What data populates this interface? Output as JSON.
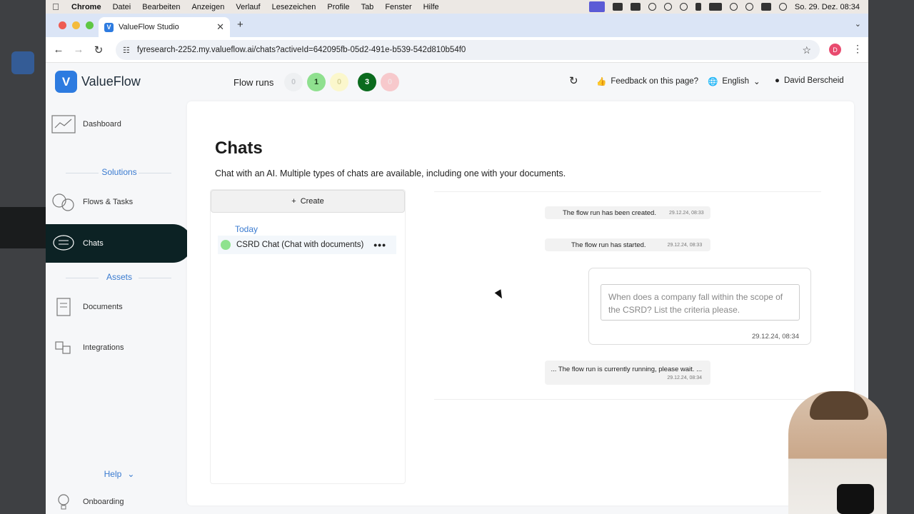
{
  "menubar": {
    "app": "Chrome",
    "items": [
      "Datei",
      "Bearbeiten",
      "Anzeigen",
      "Verlauf",
      "Lesezeichen",
      "Profile",
      "Tab",
      "Fenster",
      "Hilfe"
    ],
    "clock": "So. 29. Dez. 08:34"
  },
  "browser": {
    "tab_title": "ValueFlow Studio",
    "url": "fyresearch-2252.my.valueflow.ai/chats?activeId=642095fb-05d2-491e-b539-542d810b54f0",
    "profile_initial": "D"
  },
  "header": {
    "brand": "ValueFlow",
    "flow_runs_label": "Flow runs",
    "flow_runs": [
      {
        "value": "0",
        "bg": "#eef0f2",
        "fg": "#c5c8cc"
      },
      {
        "value": "1",
        "bg": "#8fe08f",
        "fg": "#1b3d1b"
      },
      {
        "value": "0",
        "bg": "#fbf7cc",
        "fg": "#d8d39a"
      },
      {
        "value": "3",
        "bg": "#0b6b1e",
        "fg": "#ffffff"
      },
      {
        "value": "0",
        "bg": "#f7c9cc",
        "fg": "#f3e1e2"
      }
    ],
    "feedback": "Feedback on this page?",
    "language": "English",
    "user": "David Berscheid"
  },
  "sidebar": {
    "dashboard": "Dashboard",
    "solutions_section": "Solutions",
    "flows_tasks": "Flows & Tasks",
    "chats": "Chats",
    "assets_section": "Assets",
    "documents": "Documents",
    "integrations": "Integrations",
    "help": "Help",
    "onboarding": "Onboarding"
  },
  "page": {
    "title": "Chats",
    "subtitle": "Chat with an AI. Multiple types of chats are available, including one with your documents.",
    "create_label": "Create",
    "group_label": "Today",
    "chat_name": "CSRD Chat (Chat with documents)"
  },
  "conversation": {
    "created_msg": "The flow run has been created.",
    "created_ts": "29.12.24, 08:33",
    "started_msg": "The flow run has started.",
    "started_ts": "29.12.24, 08:33",
    "user_msg": "When does a company fall within the scope of the CSRD? List the criteria please.",
    "user_ts": "29.12.24, 08:34",
    "running_msg": "... The flow run is currently running, please wait. ...",
    "running_ts": "29.12.24, 08:34"
  }
}
